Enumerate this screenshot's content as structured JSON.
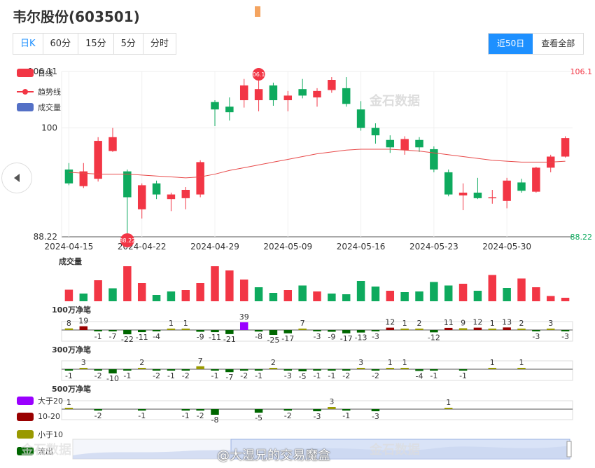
{
  "title": "韦尔股份(603501)",
  "tabs": [
    "日K",
    "60分",
    "15分",
    "5分",
    "分时"
  ],
  "range_buttons": {
    "recent": "近50日",
    "all": "查看全部"
  },
  "legend_main": {
    "kline": "日线",
    "trend": "趋势线",
    "volume": "成交量"
  },
  "watermark": "金石数据",
  "price_axis": {
    "top": "106.11",
    "mid": "100",
    "bottom": "88.22",
    "right_top": "106.1",
    "right_bottom": "88.22"
  },
  "badges": {
    "high": "06.1",
    "low": "88.22"
  },
  "volume_title": "成交量",
  "panel_titles": [
    "100万净笔",
    "300万净笔",
    "500万净笔"
  ],
  "flow_legend": [
    "大于20",
    "10-20",
    "小于10",
    "流出"
  ],
  "weibo_watermark": "@大湿兄的交易魔盒",
  "colors": {
    "up": "#f23645",
    "down": "#0eaa5e",
    "trend": "#e84a4a",
    "gt20": "#9a00ff",
    "b1020": "#990000",
    "lt10": "#999900",
    "out": "#006600",
    "accent": "#1e90ff"
  },
  "chart_data": {
    "type": "candlestick",
    "x_ticks": [
      "2024-04-15",
      "2024-04-22",
      "2024-04-29",
      "2024-05-09",
      "2024-05-16",
      "2024-05-23",
      "2024-05-30"
    ],
    "ylim": [
      88.22,
      106.11
    ],
    "candles": [
      {
        "o": 95.5,
        "c": 94.0,
        "h": 96.2,
        "l": 93.8
      },
      {
        "o": 93.7,
        "c": 95.3,
        "h": 96.2,
        "l": 93.5
      },
      {
        "o": 94.5,
        "c": 98.6,
        "h": 99.0,
        "l": 94.2
      },
      {
        "o": 97.5,
        "c": 99.0,
        "h": 100.0,
        "l": 97.4
      },
      {
        "o": 95.3,
        "c": 92.5,
        "h": 95.5,
        "l": 88.5
      },
      {
        "o": 91.2,
        "c": 93.8,
        "h": 94.0,
        "l": 90.2
      },
      {
        "o": 94.0,
        "c": 92.8,
        "h": 94.3,
        "l": 92.3
      },
      {
        "o": 92.3,
        "c": 92.8,
        "h": 93.0,
        "l": 91.0
      },
      {
        "o": 92.4,
        "c": 93.3,
        "h": 93.6,
        "l": 91.2
      },
      {
        "o": 92.8,
        "c": 96.3,
        "h": 96.5,
        "l": 92.5
      },
      {
        "o": 102.8,
        "c": 102.0,
        "h": 103.0,
        "l": 100.2
      },
      {
        "o": 102.3,
        "c": 101.7,
        "h": 103.3,
        "l": 100.8
      },
      {
        "o": 103.0,
        "c": 104.6,
        "h": 105.3,
        "l": 102.2
      },
      {
        "o": 103.0,
        "c": 104.2,
        "h": 105.5,
        "l": 101.8
      },
      {
        "o": 104.6,
        "c": 103.0,
        "h": 104.9,
        "l": 102.4
      },
      {
        "o": 103.0,
        "c": 103.5,
        "h": 104.0,
        "l": 101.8
      },
      {
        "o": 104.2,
        "c": 103.5,
        "h": 105.3,
        "l": 103.2
      },
      {
        "o": 103.3,
        "c": 104.0,
        "h": 104.3,
        "l": 102.3
      },
      {
        "o": 104.1,
        "c": 105.2,
        "h": 105.5,
        "l": 103.8
      },
      {
        "o": 104.3,
        "c": 102.6,
        "h": 105.5,
        "l": 102.3
      },
      {
        "o": 102.0,
        "c": 100.0,
        "h": 102.9,
        "l": 99.7
      },
      {
        "o": 100.0,
        "c": 99.2,
        "h": 100.5,
        "l": 98.3
      },
      {
        "o": 98.7,
        "c": 97.9,
        "h": 99.2,
        "l": 97.3
      },
      {
        "o": 97.6,
        "c": 98.8,
        "h": 99.1,
        "l": 97.1
      },
      {
        "o": 98.7,
        "c": 97.9,
        "h": 99.0,
        "l": 97.4
      },
      {
        "o": 97.7,
        "c": 95.5,
        "h": 98.0,
        "l": 95.2
      },
      {
        "o": 95.2,
        "c": 92.8,
        "h": 95.5,
        "l": 92.6
      },
      {
        "o": 92.7,
        "c": 93.0,
        "h": 94.0,
        "l": 91.1
      },
      {
        "o": 93.0,
        "c": 92.4,
        "h": 94.6,
        "l": 92.3
      },
      {
        "o": 92.5,
        "c": 92.5,
        "h": 93.3,
        "l": 91.8
      },
      {
        "o": 92.1,
        "c": 94.3,
        "h": 94.6,
        "l": 91.3
      },
      {
        "o": 94.1,
        "c": 93.2,
        "h": 94.5,
        "l": 93.0
      },
      {
        "o": 93.1,
        "c": 95.7,
        "h": 95.8,
        "l": 93.0
      },
      {
        "o": 95.7,
        "c": 96.9,
        "h": 97.1,
        "l": 95.2
      },
      {
        "o": 96.9,
        "c": 98.9,
        "h": 99.1,
        "l": 96.8
      }
    ],
    "trend": [
      95.2,
      95.1,
      95.0,
      95.0,
      95.0,
      94.9,
      94.8,
      94.7,
      94.6,
      94.7,
      95.0,
      95.4,
      95.7,
      96.0,
      96.3,
      96.6,
      96.9,
      97.2,
      97.4,
      97.6,
      97.7,
      97.7,
      97.7,
      97.6,
      97.5,
      97.3,
      97.1,
      96.9,
      96.7,
      96.5,
      96.4,
      96.3,
      96.3,
      96.3,
      96.4
    ],
    "volume": [
      0.33,
      0.22,
      0.6,
      0.37,
      1.0,
      0.52,
      0.18,
      0.28,
      0.32,
      0.52,
      1.0,
      0.88,
      0.62,
      0.4,
      0.24,
      0.32,
      0.45,
      0.28,
      0.22,
      0.2,
      0.58,
      0.42,
      0.3,
      0.26,
      0.28,
      0.55,
      0.45,
      0.5,
      0.3,
      0.75,
      0.38,
      0.65,
      0.4,
      0.15,
      0.1
    ],
    "volume_up": [
      1,
      0,
      1,
      0,
      1,
      1,
      0,
      0,
      1,
      1,
      1,
      1,
      1,
      0,
      0,
      1,
      0,
      1,
      0,
      0,
      0,
      0,
      1,
      0,
      0,
      0,
      0,
      1,
      0,
      1,
      0,
      1,
      1,
      1,
      1
    ],
    "net_100": [
      8,
      19,
      -1,
      -7,
      -22,
      -11,
      -4,
      1,
      1,
      -9,
      -11,
      -21,
      39,
      -8,
      -25,
      -17,
      7,
      -3,
      -9,
      -17,
      -13,
      -3,
      12,
      1,
      2,
      -12,
      11,
      9,
      12,
      1,
      13,
      2,
      -3,
      3,
      -3
    ],
    "net_300": [
      -1,
      3,
      -2,
      -10,
      -1,
      2,
      -2,
      -1,
      -2,
      7,
      -1,
      -7,
      -2,
      -1,
      2,
      -3,
      -5,
      -1,
      -1,
      -2,
      3,
      -2,
      1,
      1,
      -4,
      -1,
      0,
      -1,
      0,
      1,
      0,
      1,
      0,
      0,
      0
    ],
    "net_500": [
      1,
      0,
      -2,
      0,
      0,
      -1,
      0,
      0,
      -1,
      -2,
      -8,
      0,
      0,
      -5,
      0,
      -2,
      0,
      -3,
      3,
      -1,
      0,
      -3,
      0,
      0,
      0,
      0,
      1,
      0,
      0,
      0,
      0,
      0,
      0,
      0,
      0
    ]
  }
}
